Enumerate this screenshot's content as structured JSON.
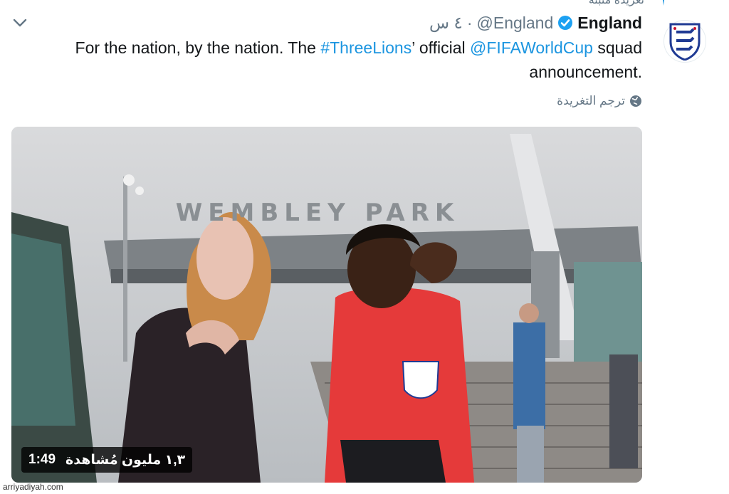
{
  "tweet": {
    "pinned_label": "تغريدة مثبتة",
    "display_name": "England",
    "handle": "@England",
    "separator": "·",
    "timestamp": "٤ س",
    "text": {
      "part1": "For the nation, by the nation. The ",
      "hashtag": "#ThreeLions",
      "part2": "’ official ",
      "mention": "@FIFAWorldCup",
      "part3": " squad announcement."
    },
    "translate_label": "ترجم التغريدة"
  },
  "video": {
    "duration": "1:49",
    "views": "١,٣ مليون مُشاهدة",
    "sign_text": "WEMBLEY PARK"
  },
  "watermark": "arriyadiyah.com",
  "colors": {
    "link": "#1b95e0",
    "verified": "#1da1f2",
    "secondary_text": "#657786"
  },
  "icons": {
    "caret": "chevron-down-icon",
    "verified": "verified-badge-icon",
    "globe": "globe-icon",
    "pin": "pin-icon",
    "avatar": "three-lions-crest"
  }
}
